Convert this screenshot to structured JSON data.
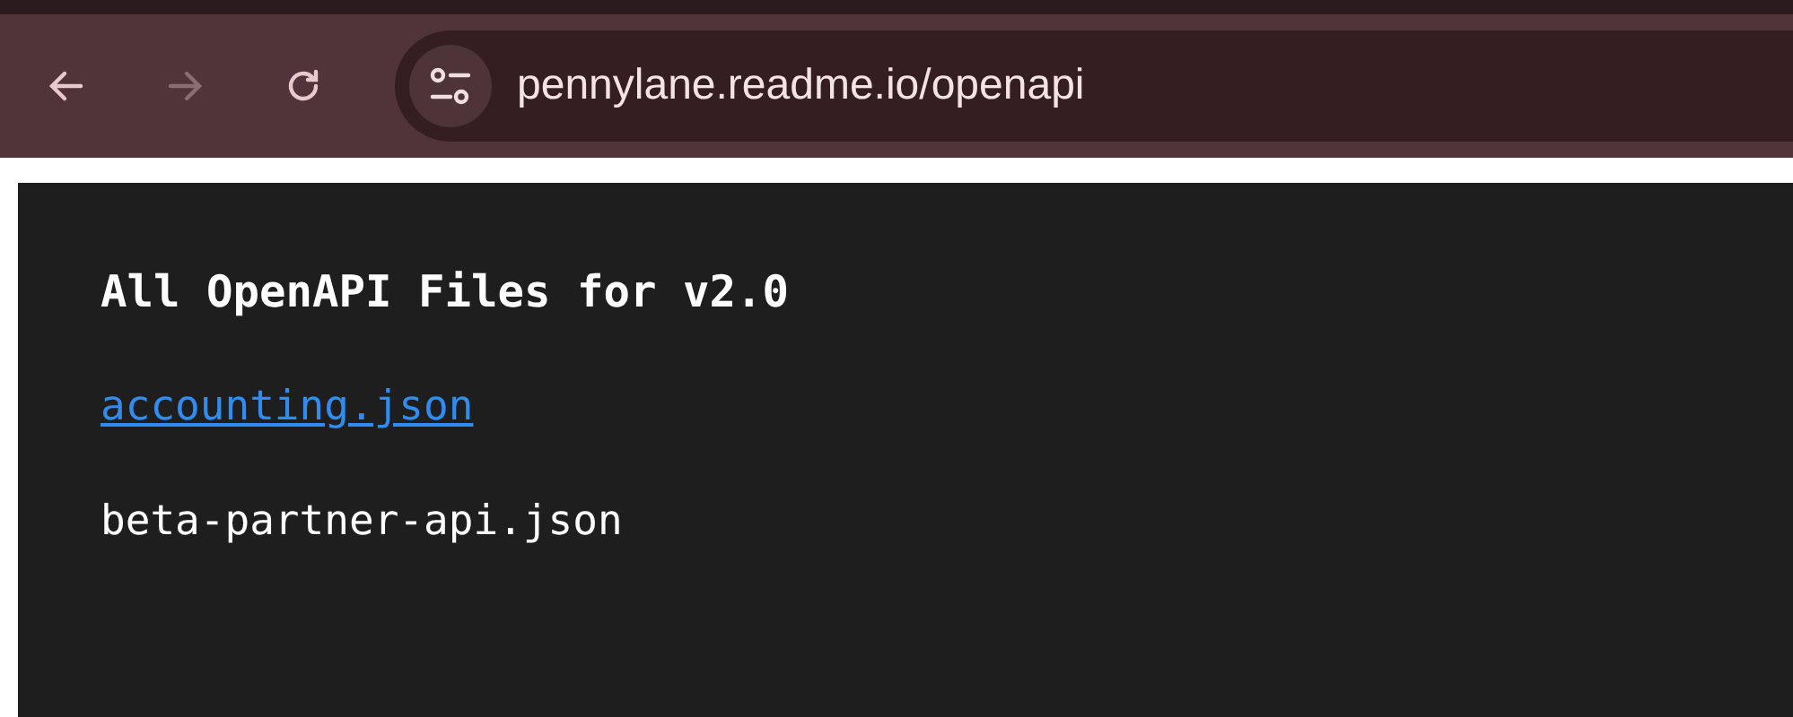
{
  "browser": {
    "nav_buttons": [
      {
        "kind": "back",
        "disabled": false
      },
      {
        "kind": "forward",
        "disabled": true
      },
      {
        "kind": "reload",
        "disabled": false
      }
    ],
    "address": "pennylane.readme.io/openapi"
  },
  "page": {
    "heading": "All OpenAPI Files for v2.0",
    "files": [
      {
        "name": "accounting.json",
        "kind": "link"
      },
      {
        "name": "beta-partner-api.json",
        "kind": "plain"
      }
    ]
  }
}
